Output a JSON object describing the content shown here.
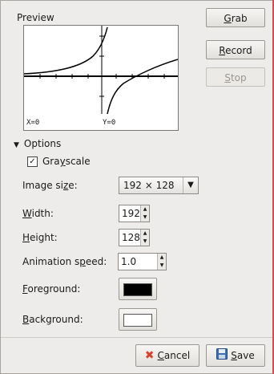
{
  "preview": {
    "label": "Preview",
    "readout_x": "X=0",
    "readout_y": "Y=0"
  },
  "actions": {
    "grab": {
      "prefix": "",
      "mnemonic": "G",
      "rest": "rab"
    },
    "record": {
      "prefix": "",
      "mnemonic": "R",
      "rest": "ecord"
    },
    "stop": {
      "prefix": "",
      "mnemonic": "S",
      "rest": "top",
      "enabled": false
    }
  },
  "options": {
    "toggle_label": "Options",
    "grayscale": {
      "pre": "Gra",
      "mnemonic": "y",
      "post": "scale",
      "checked": true,
      "check_glyph": "✓"
    },
    "image_size": {
      "label_pre": "Image si",
      "label_mnemonic": "z",
      "label_post": "e:",
      "value": "192 × 128"
    },
    "width": {
      "label_mnemonic": "W",
      "label_post": "idth:",
      "value": "192"
    },
    "height": {
      "label_mnemonic": "H",
      "label_post": "eight:",
      "value": "128"
    },
    "animation_speed": {
      "label_pre": "Animation s",
      "label_mnemonic": "p",
      "label_post": "eed:",
      "value": "1.0"
    },
    "foreground": {
      "label_mnemonic": "F",
      "label_post": "oreground:",
      "color": "#000000"
    },
    "background": {
      "label_mnemonic": "B",
      "label_post": "ackground:",
      "color": "#ffffff"
    }
  },
  "footer": {
    "cancel": {
      "mnemonic": "C",
      "rest": "ancel"
    },
    "save": {
      "mnemonic": "S",
      "rest": "ave"
    }
  },
  "colors": {
    "window_bg": "#edecea",
    "accent_border": "#c85050",
    "cancel_icon": "#d9412e",
    "save_icon": "#3d6fb5"
  },
  "icons": {
    "options_toggle": "triangle-down-icon",
    "cancel": "cancel-x-icon",
    "save": "floppy-disk-icon",
    "spin": "spin-arrows-icon",
    "dropdown": "chevron-down-icon"
  }
}
